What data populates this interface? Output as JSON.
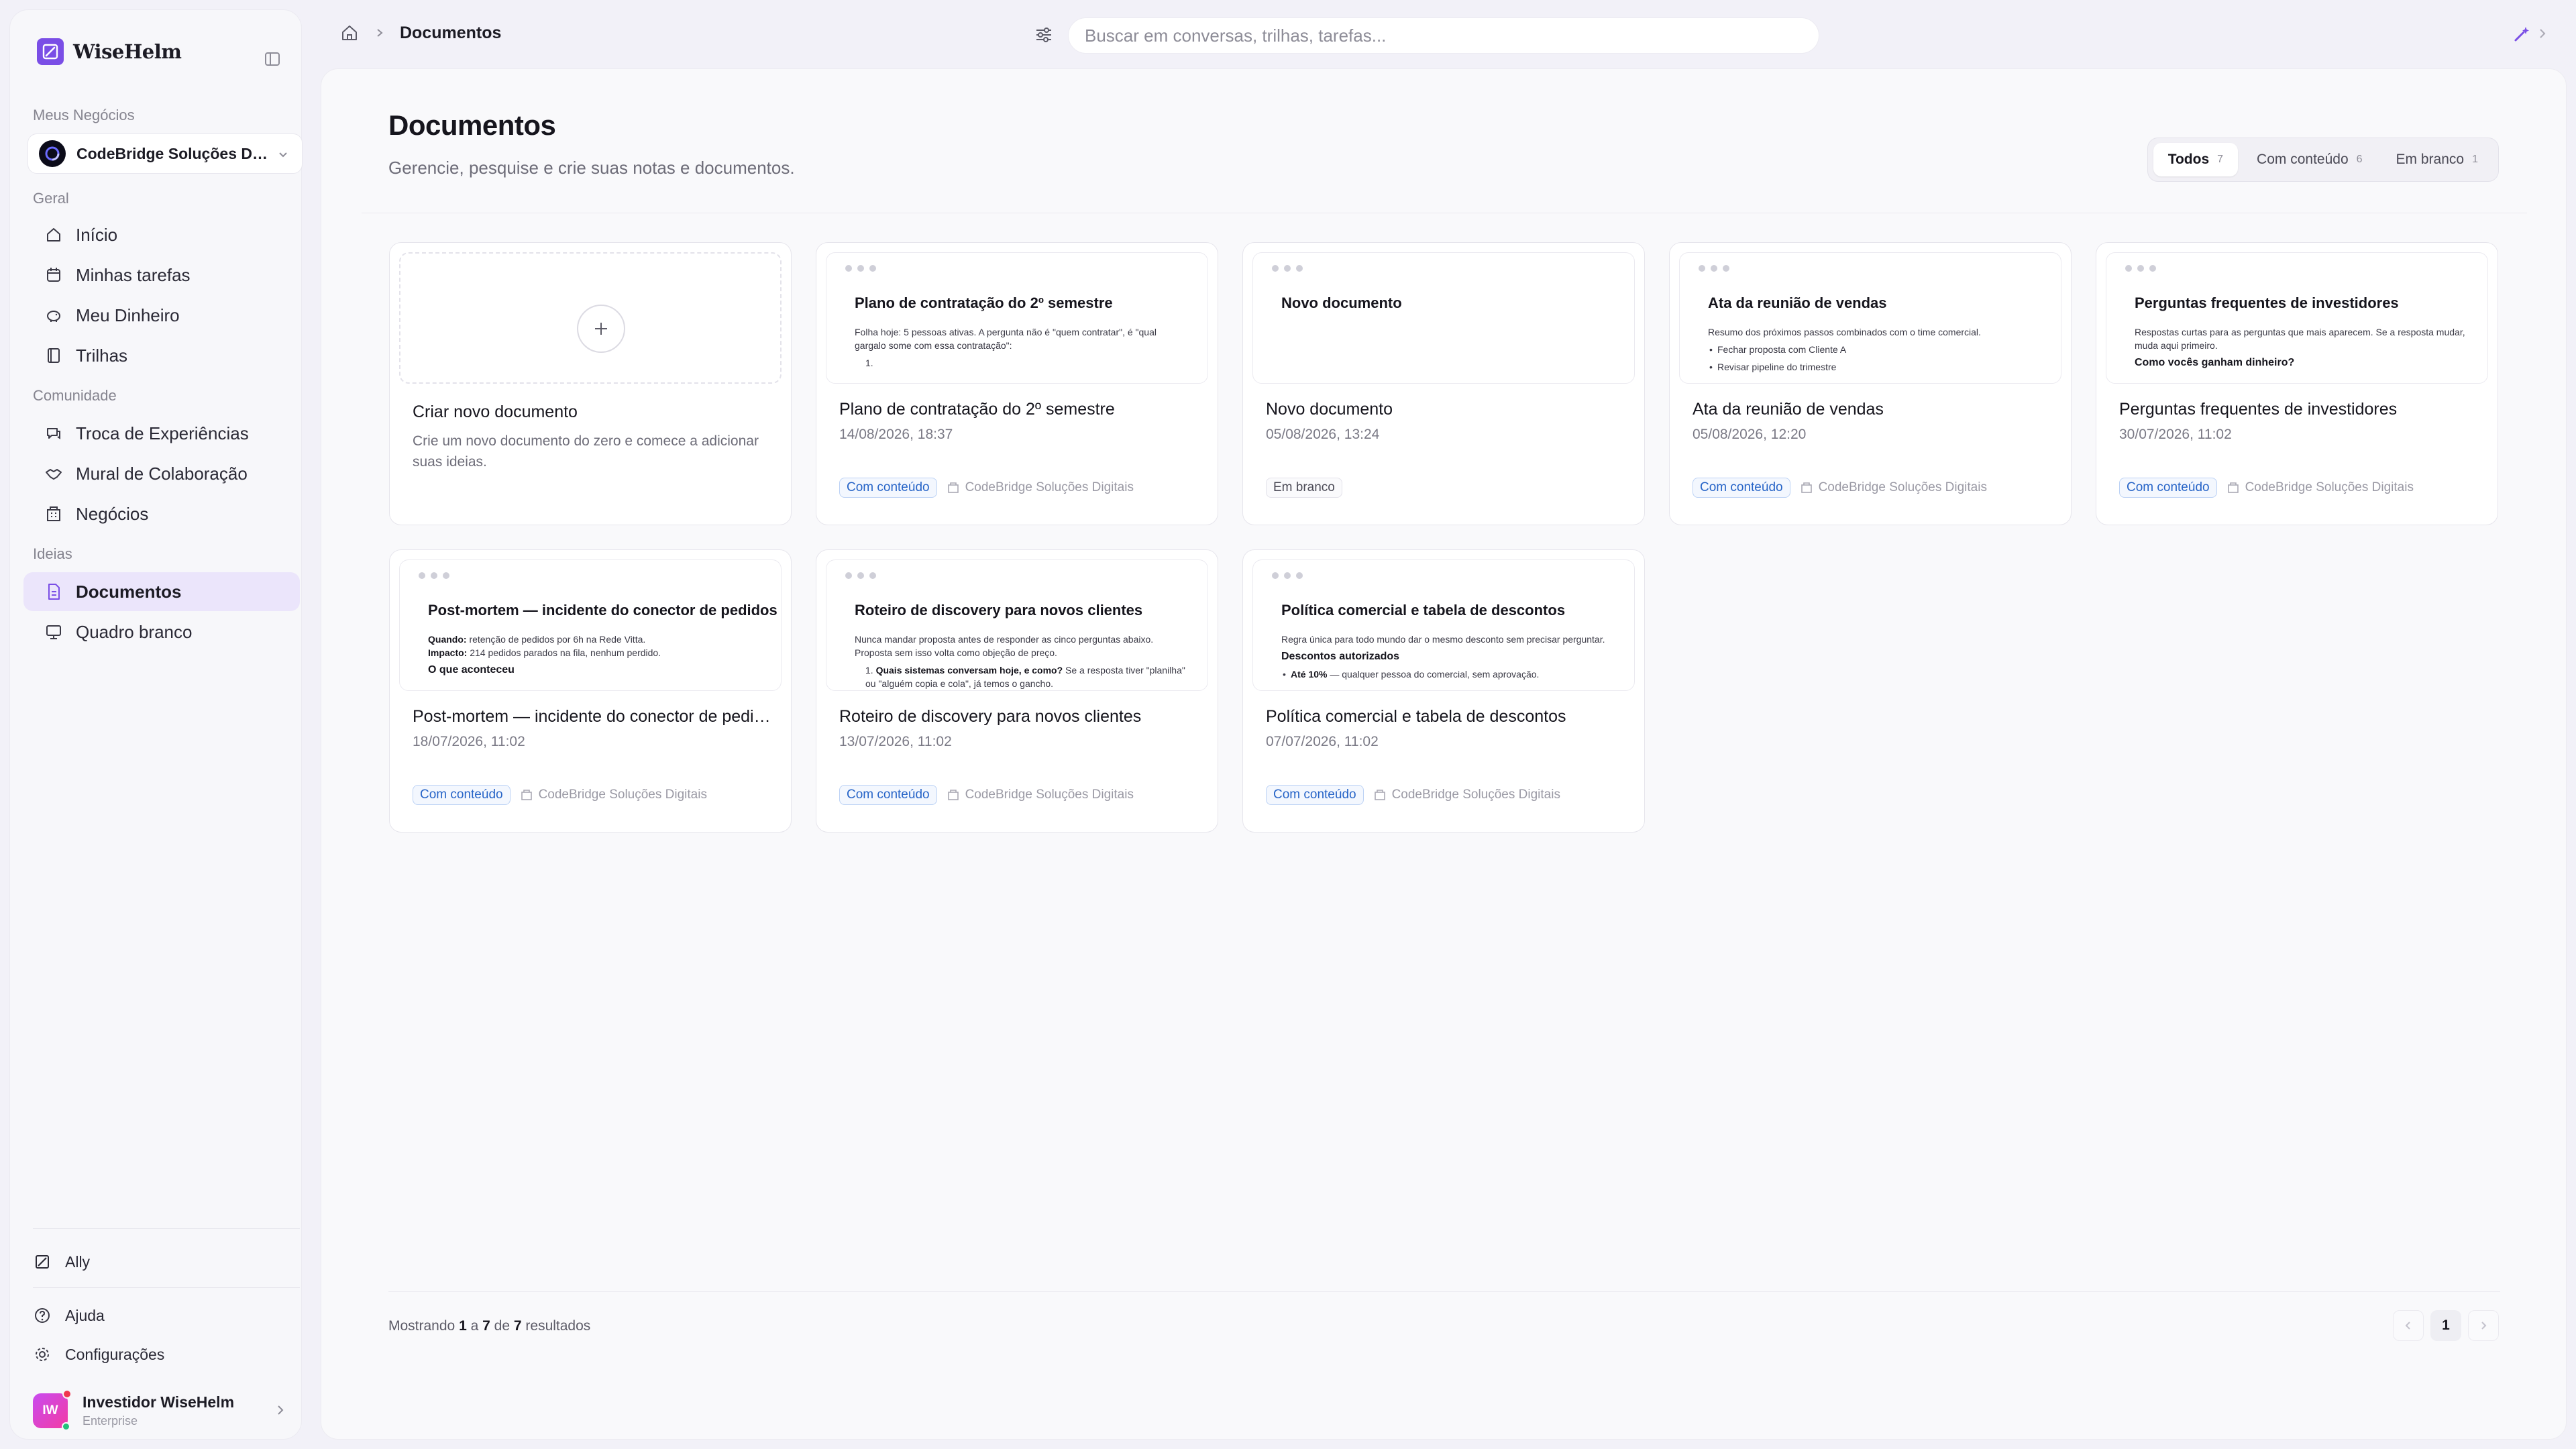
{
  "app": {
    "name": "WiseHelm"
  },
  "sidebar": {
    "business_section_label": "Meus Negócios",
    "business_name": "CodeBridge Soluções Digitais",
    "groups": [
      {
        "label": "Geral",
        "items": [
          {
            "label": "Início",
            "icon": "home-icon"
          },
          {
            "label": "Minhas tarefas",
            "icon": "calendar-icon"
          },
          {
            "label": "Meu Dinheiro",
            "icon": "piggy-bank-icon"
          },
          {
            "label": "Trilhas",
            "icon": "book-icon"
          }
        ]
      },
      {
        "label": "Comunidade",
        "items": [
          {
            "label": "Troca de Experiências",
            "icon": "chat-icon"
          },
          {
            "label": "Mural de Colaboração",
            "icon": "handshake-icon"
          },
          {
            "label": "Negócios",
            "icon": "building-icon"
          }
        ]
      },
      {
        "label": "Ideias",
        "items": [
          {
            "label": "Documentos",
            "icon": "document-icon",
            "active": true
          },
          {
            "label": "Quadro branco",
            "icon": "monitor-icon"
          }
        ]
      }
    ],
    "ally_label": "Ally",
    "help_label": "Ajuda",
    "settings_label": "Configurações",
    "user": {
      "initials": "IW",
      "name": "Investidor WiseHelm",
      "plan": "Enterprise"
    }
  },
  "topbar": {
    "breadcrumb": "Documentos",
    "search_placeholder": "Buscar em conversas, trilhas, tarefas..."
  },
  "page": {
    "title": "Documentos",
    "subtitle": "Gerencie, pesquise e crie suas notas e documentos.",
    "filters": [
      {
        "label": "Todos",
        "count": "7",
        "active": true
      },
      {
        "label": "Com conteúdo",
        "count": "6"
      },
      {
        "label": "Em branco",
        "count": "1"
      }
    ],
    "new_card": {
      "title": "Criar novo documento",
      "desc": "Crie um novo documento do zero e comece a adicionar suas ideias."
    },
    "documents": [
      {
        "preview_title": "Plano de contratação do 2º semestre",
        "preview_lines": [
          "Folha hoje: 5 pessoas ativas. A pergunta não é \"quem contratar\", é \"qual gargalo some com essa contratação\":",
          "1."
        ],
        "title": "Plano de contratação do 2º semestre",
        "date": "14/08/2026, 18:37",
        "tag": "Com conteúdo",
        "tag_type": "content",
        "business": "CodeBridge Soluções Digitais"
      },
      {
        "preview_title": "Novo documento",
        "preview_lines": [],
        "title": "Novo documento",
        "date": "05/08/2026, 13:24",
        "tag": "Em branco",
        "tag_type": "blank",
        "business": ""
      },
      {
        "preview_title": "Ata da reunião de vendas",
        "preview_lines": [
          "Resumo dos próximos passos combinados com o time comercial.",
          "Fechar proposta com Cliente A",
          "Revisar pipeline do trimestre"
        ],
        "title": "Ata da reunião de vendas",
        "date": "05/08/2026, 12:20",
        "tag": "Com conteúdo",
        "tag_type": "content",
        "business": "CodeBridge Soluções Digitais"
      },
      {
        "preview_title": "Perguntas frequentes de investidores",
        "preview_lines": [
          "Respostas curtas para as perguntas que mais aparecem. Se a resposta mudar, muda aqui primeiro.",
          "Como vocês ganham dinheiro?"
        ],
        "title": "Perguntas frequentes de investidores",
        "date": "30/07/2026, 11:02",
        "tag": "Com conteúdo",
        "tag_type": "content",
        "business": "CodeBridge Soluções Digitais"
      },
      {
        "preview_title": "Post-mortem — incidente do conector de pedidos",
        "preview_lines": [
          "Quando:",
          "retenção de pedidos por 6h na Rede Vitta.",
          "Impacto:",
          "214 pedidos parados na fila, nenhum perdido.",
          "O que aconteceu"
        ],
        "title": "Post-mortem — incidente do conector de pedidos",
        "date": "18/07/2026, 11:02",
        "tag": "Com conteúdo",
        "tag_type": "content",
        "business": "CodeBridge Soluções Digitais"
      },
      {
        "preview_title": "Roteiro de discovery para novos clientes",
        "preview_lines": [
          "Nunca mandar proposta antes de responder as cinco perguntas abaixo. Proposta sem isso volta como objeção de preço.",
          "Quais sistemas conversam hoje, e como?",
          "Se a resposta tiver \"planilha\" ou \"alguém copia e cola\", já temos o gancho."
        ],
        "title": "Roteiro de discovery para novos clientes",
        "date": "13/07/2026, 11:02",
        "tag": "Com conteúdo",
        "tag_type": "content",
        "business": "CodeBridge Soluções Digitais"
      },
      {
        "preview_title": "Política comercial e tabela de descontos",
        "preview_lines": [
          "Regra única para todo mundo dar o mesmo desconto sem precisar perguntar.",
          "Descontos autorizados",
          "Até 10%",
          "— qualquer pessoa do comercial, sem aprovação."
        ],
        "title": "Política comercial e tabela de descontos",
        "date": "07/07/2026, 11:02",
        "tag": "Com conteúdo",
        "tag_type": "content",
        "business": "CodeBridge Soluções Digitais"
      }
    ],
    "results": {
      "prefix": "Mostrando",
      "from": "1",
      "a": "a",
      "to": "7",
      "de": "de",
      "total": "7",
      "suffix": "resultados"
    },
    "pagination": {
      "current": "1"
    }
  },
  "colors": {
    "accent": "#7a4ee6",
    "active_bg": "#ebe5fb",
    "content_tag": "#2563c7"
  }
}
